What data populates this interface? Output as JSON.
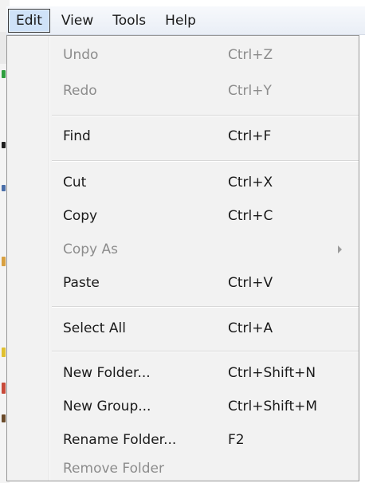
{
  "menubar": {
    "items": [
      {
        "label": "Edit",
        "active": true
      },
      {
        "label": "View"
      },
      {
        "label": "Tools"
      },
      {
        "label": "Help"
      }
    ]
  },
  "edit_menu": {
    "items": [
      {
        "label": "Undo",
        "shortcut": "Ctrl+Z",
        "enabled": false
      },
      {
        "label": "Redo",
        "shortcut": "Ctrl+Y",
        "enabled": false
      },
      {
        "label": "Find",
        "shortcut": "Ctrl+F",
        "enabled": true
      },
      {
        "label": "Cut",
        "shortcut": "Ctrl+X",
        "enabled": true
      },
      {
        "label": "Copy",
        "shortcut": "Ctrl+C",
        "enabled": true
      },
      {
        "label": "Copy As",
        "shortcut": "",
        "enabled": false,
        "submenu_icon": "chevron-right-icon"
      },
      {
        "label": "Paste",
        "shortcut": "Ctrl+V",
        "enabled": true
      },
      {
        "label": "Select All",
        "shortcut": "Ctrl+A",
        "enabled": true
      },
      {
        "label": "New Folder...",
        "shortcut": "Ctrl+Shift+N",
        "enabled": true
      },
      {
        "label": "New Group...",
        "shortcut": "Ctrl+Shift+M",
        "enabled": true
      },
      {
        "label": "Rename Folder...",
        "shortcut": "F2",
        "enabled": true
      },
      {
        "label": "Remove Folder",
        "shortcut": "",
        "enabled": false
      }
    ]
  },
  "colors": {
    "active_menu_bg": "#cfe2f8",
    "menu_bg": "#f2f2f2",
    "disabled_text": "#8c8c8c",
    "enabled_text": "#1a1a1a"
  }
}
